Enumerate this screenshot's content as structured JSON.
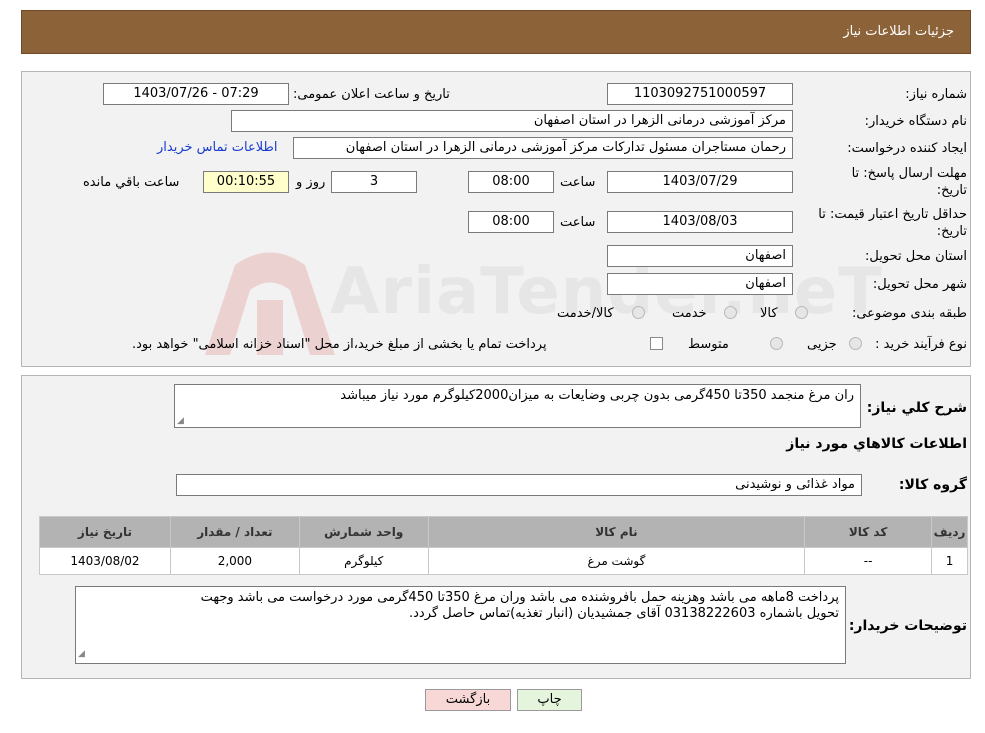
{
  "header": {
    "title": "جزئیات اطلاعات نیاز"
  },
  "form": {
    "need_number_label": "شماره نیاز:",
    "need_number": "1103092751000597",
    "announce_label": "تاریخ و ساعت اعلان عمومی:",
    "announce_value": "1403/07/26 - 07:29",
    "buyer_org_label": "نام دستگاه خریدار:",
    "buyer_org": "مرکز آموزشی درمانی الزهرا در استان اصفهان",
    "creator_label": "ایجاد کننده درخواست:",
    "creator": "رحمان مستاجران مسئول تدارکات مرکز آموزشی درمانی الزهرا در استان اصفهان",
    "contact_link": "اطلاعات تماس خریدار",
    "reply_deadline_label_1": "مهلت ارسال پاسخ: تا",
    "reply_deadline_label_2": "تاریخ:",
    "reply_date": "1403/07/29",
    "hour_label": "ساعت",
    "reply_time": "08:00",
    "days_value": "3",
    "days_label": "روز و",
    "remaining_time": "00:10:55",
    "remaining_label": "ساعت باقي مانده",
    "price_validity_label_1": "حداقل تاریخ اعتبار قیمت: تا",
    "price_validity_label_2": "تاریخ:",
    "validity_date": "1403/08/03",
    "validity_time": "08:00",
    "province_label": "استان محل تحویل:",
    "province": "اصفهان",
    "city_label": "شهر محل تحویل:",
    "city": "اصفهان",
    "category_label": "طبقه بندی موضوعی:",
    "category_options": [
      "کالا",
      "خدمت",
      "کالا/خدمت"
    ],
    "process_label": "نوع فرآیند خرید :",
    "process_options": [
      "جزیی",
      "متوسط"
    ],
    "payment_note": "پرداخت تمام یا بخشی از مبلغ خرید،از محل \"اسناد خزانه اسلامی\" خواهد بود."
  },
  "description": {
    "label": "شرح كلي نياز:",
    "text": "ران مرغ منجمد 350تا 450گرمی بدون چربی وضایعات به میزان2000کیلوگرم مورد نیاز میباشد"
  },
  "goods": {
    "section_title": "اطلاعات کالاهاي مورد نياز",
    "group_label": "گروه کالا:",
    "group_value": "مواد غذائی و نوشیدنی",
    "columns": [
      "ردیف",
      "کد کالا",
      "نام کالا",
      "واحد شمارش",
      "تعداد / مقدار",
      "تاریخ نیاز"
    ],
    "rows": [
      [
        "1",
        "--",
        "گوشت مرغ",
        "کیلوگرم",
        "2,000",
        "1403/08/02"
      ]
    ]
  },
  "buyer_notes": {
    "label": "توضیحات خریدار:",
    "line1": "پرداخت 8ماهه می باشد وهزینه حمل بافروشنده می باشد وران مرغ 350تا 450گرمی مورد درخواست می باشد وجهت",
    "line2": "تحویل باشماره 03138222603 آقای جمشیدیان (انبار تغذیه)تماس حاصل گردد."
  },
  "buttons": {
    "print": "چاپ",
    "back": "بازگشت"
  },
  "watermark": {
    "text": "AriaTender.neT"
  },
  "colors": {
    "title_bg": "#8c6239",
    "panel_bg": "#f2f2f2",
    "table_head": "#b3b3b3",
    "highlight": "#ffffcc",
    "back_btn": "#f8d7d7",
    "print_btn": "#e5f5dd"
  }
}
